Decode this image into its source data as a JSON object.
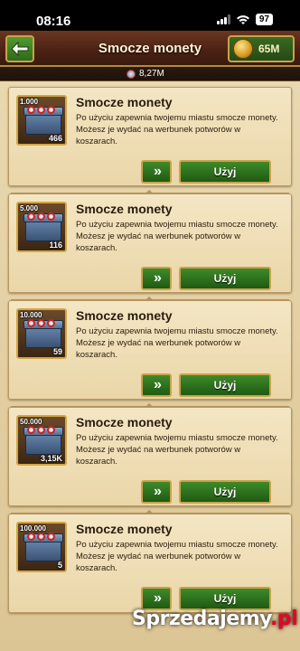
{
  "status_bar": {
    "time": "08:16",
    "battery": "97"
  },
  "header": {
    "back_icon": "back-arrow-icon",
    "title": "Smocze monety",
    "gold": "65M"
  },
  "resource_bar": {
    "value": "8,27M"
  },
  "items": [
    {
      "amount": "1.000",
      "count": "466",
      "title": "Smocze monety",
      "desc1": "Po użyciu zapewnia twojemu miastu smocze monety.",
      "desc2": "Możesz je wydać na werbunek potworów w koszarach.",
      "details_label": "»",
      "use_label": "Użyj"
    },
    {
      "amount": "5.000",
      "count": "116",
      "title": "Smocze monety",
      "desc1": "Po użyciu zapewnia twojemu miastu smocze monety.",
      "desc2": "Możesz je wydać na werbunek potworów w koszarach.",
      "details_label": "»",
      "use_label": "Użyj"
    },
    {
      "amount": "10.000",
      "count": "59",
      "title": "Smocze monety",
      "desc1": "Po użyciu zapewnia twojemu miastu smocze monety.",
      "desc2": "Możesz je wydać na werbunek potworów w koszarach.",
      "details_label": "»",
      "use_label": "Użyj"
    },
    {
      "amount": "50.000",
      "count": "3,15K",
      "title": "Smocze monety",
      "desc1": "Po użyciu zapewnia twojemu miastu smocze monety.",
      "desc2": "Możesz je wydać na werbunek potworów w koszarach.",
      "details_label": "»",
      "use_label": "Użyj"
    },
    {
      "amount": "100.000",
      "count": "5",
      "title": "Smocze monety",
      "desc1": "Po użyciu zapewnia twojemu miastu smocze monety.",
      "desc2": "Możesz je wydać na werbunek potworów w koszarach.",
      "details_label": "»",
      "use_label": "Użyj"
    }
  ],
  "watermark": {
    "text": "Sprzedajemy",
    "suffix": ".pl"
  }
}
